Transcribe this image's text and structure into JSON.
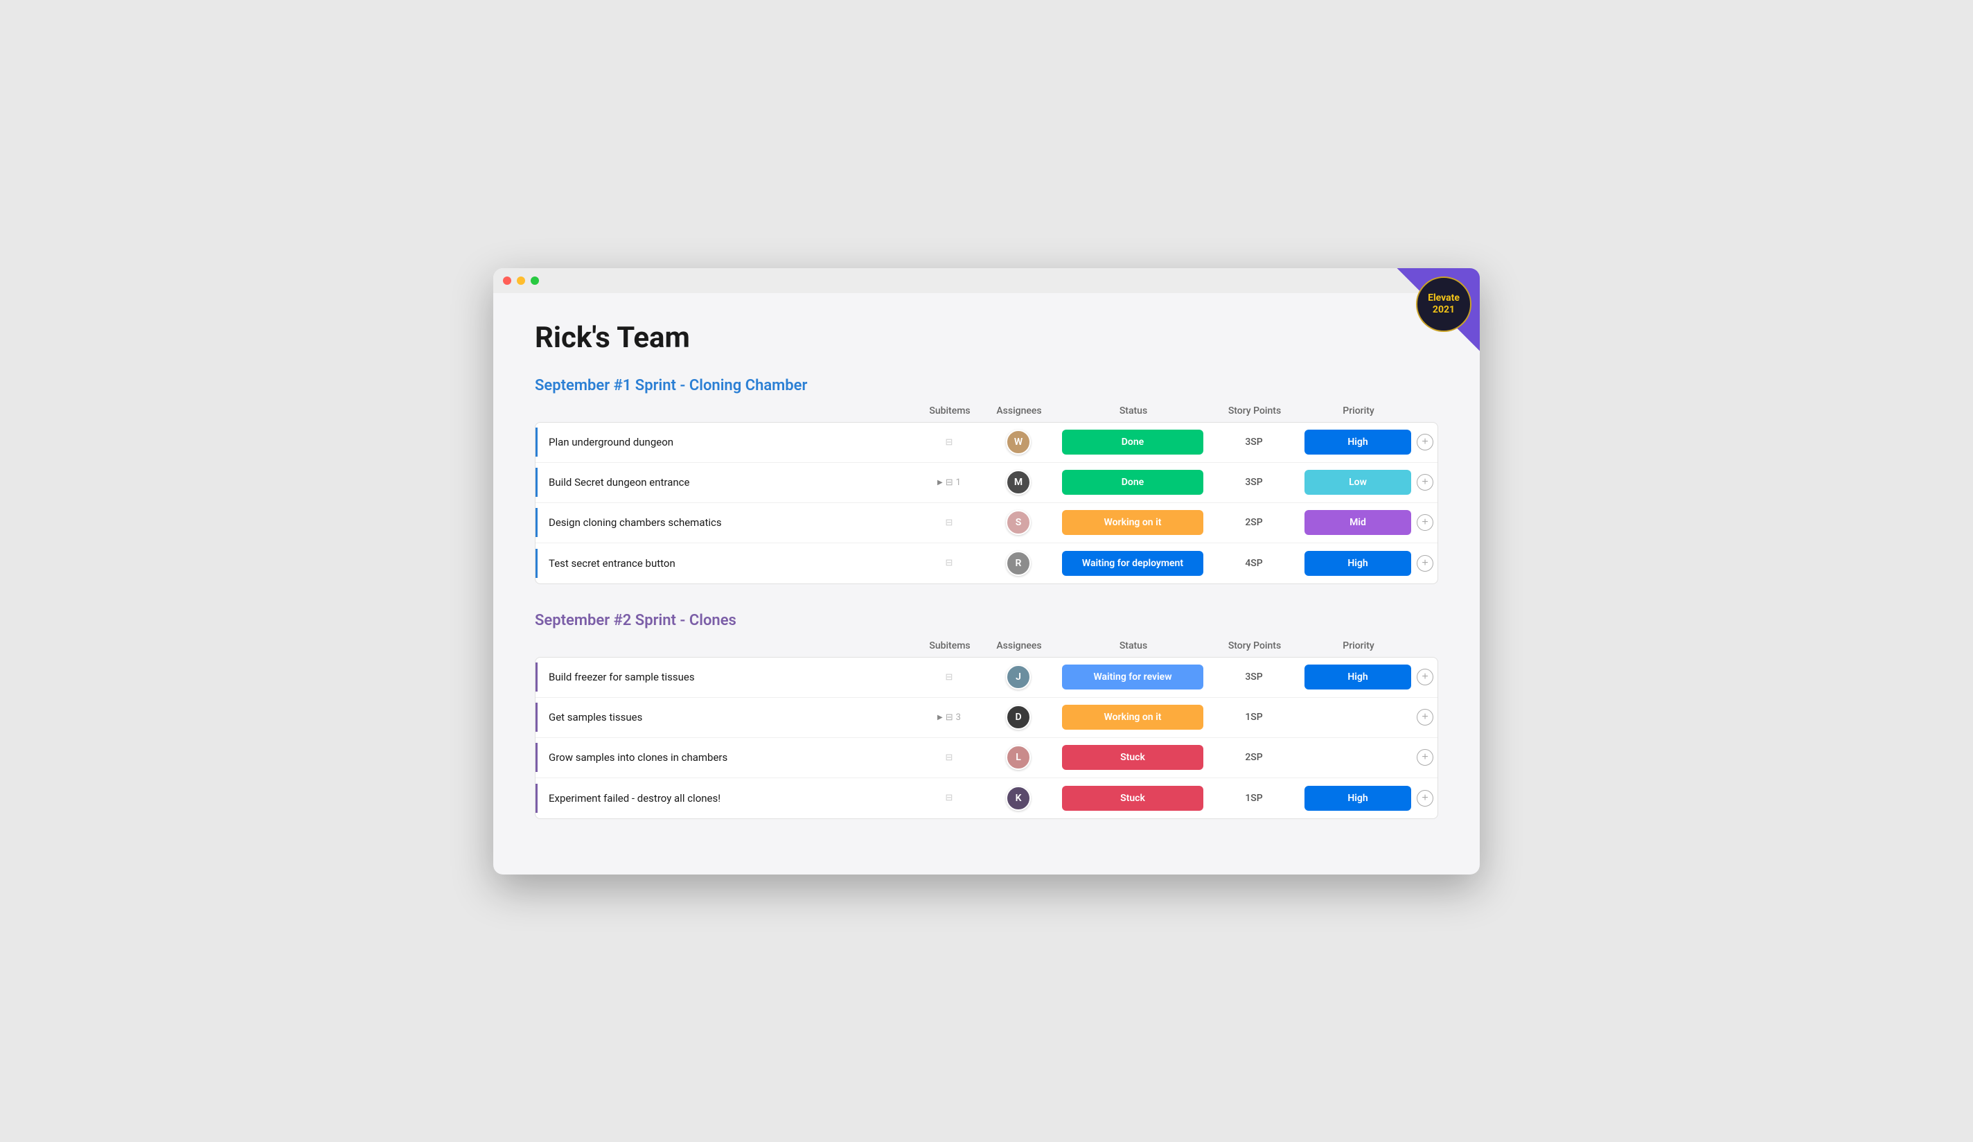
{
  "window": {
    "title": "Rick's Team"
  },
  "badge": {
    "line1": "Elevate",
    "line2": "2021"
  },
  "sprint1": {
    "title": "September #1 Sprint - Cloning Chamber",
    "color": "blue",
    "headers": {
      "subitems": "Subitems",
      "assignees": "Assignees",
      "status": "Status",
      "storyPoints": "Story Points",
      "priority": "Priority"
    },
    "rows": [
      {
        "name": "Plan underground dungeon",
        "hasSubitems": false,
        "subitemCount": null,
        "assigneeInitial": "W",
        "assigneeColor": "av1",
        "status": "Done",
        "statusClass": "status-done",
        "storyPoints": "3SP",
        "priority": "High",
        "priorityClass": "priority-high"
      },
      {
        "name": "Build Secret dungeon entrance",
        "hasSubitems": true,
        "subitemCount": "1",
        "assigneeInitial": "M",
        "assigneeColor": "av2",
        "status": "Done",
        "statusClass": "status-done",
        "storyPoints": "3SP",
        "priority": "Low",
        "priorityClass": "priority-low"
      },
      {
        "name": "Design cloning chambers schematics",
        "hasSubitems": false,
        "subitemCount": null,
        "assigneeInitial": "S",
        "assigneeColor": "av3",
        "status": "Working on it",
        "statusClass": "status-working",
        "storyPoints": "2SP",
        "priority": "Mid",
        "priorityClass": "priority-mid"
      },
      {
        "name": "Test secret entrance button",
        "hasSubitems": false,
        "subitemCount": null,
        "assigneeInitial": "R",
        "assigneeColor": "av4",
        "status": "Waiting for deployment",
        "statusClass": "status-waiting-deploy",
        "storyPoints": "4SP",
        "priority": "High",
        "priorityClass": "priority-high"
      }
    ]
  },
  "sprint2": {
    "title": "September #2 Sprint - Clones",
    "color": "purple",
    "headers": {
      "subitems": "Subitems",
      "assignees": "Assignees",
      "status": "Status",
      "storyPoints": "Story Points",
      "priority": "Priority"
    },
    "rows": [
      {
        "name": "Build freezer for sample tissues",
        "hasSubitems": false,
        "subitemCount": null,
        "assigneeInitial": "J",
        "assigneeColor": "av5",
        "status": "Waiting for review",
        "statusClass": "status-waiting-review",
        "storyPoints": "3SP",
        "priority": "High",
        "priorityClass": "priority-high"
      },
      {
        "name": "Get samples tissues",
        "hasSubitems": true,
        "subitemCount": "3",
        "assigneeInitial": "D",
        "assigneeColor": "av6",
        "status": "Working on it",
        "statusClass": "status-working",
        "storyPoints": "1SP",
        "priority": "",
        "priorityClass": ""
      },
      {
        "name": "Grow samples into clones in chambers",
        "hasSubitems": false,
        "subitemCount": null,
        "assigneeInitial": "L",
        "assigneeColor": "av7",
        "status": "Stuck",
        "statusClass": "status-stuck",
        "storyPoints": "2SP",
        "priority": "",
        "priorityClass": ""
      },
      {
        "name": "Experiment failed - destroy all clones!",
        "hasSubitems": false,
        "subitemCount": null,
        "assigneeInitial": "K",
        "assigneeColor": "av8",
        "status": "Stuck",
        "statusClass": "status-stuck",
        "storyPoints": "1SP",
        "priority": "High",
        "priorityClass": "priority-high"
      }
    ]
  }
}
